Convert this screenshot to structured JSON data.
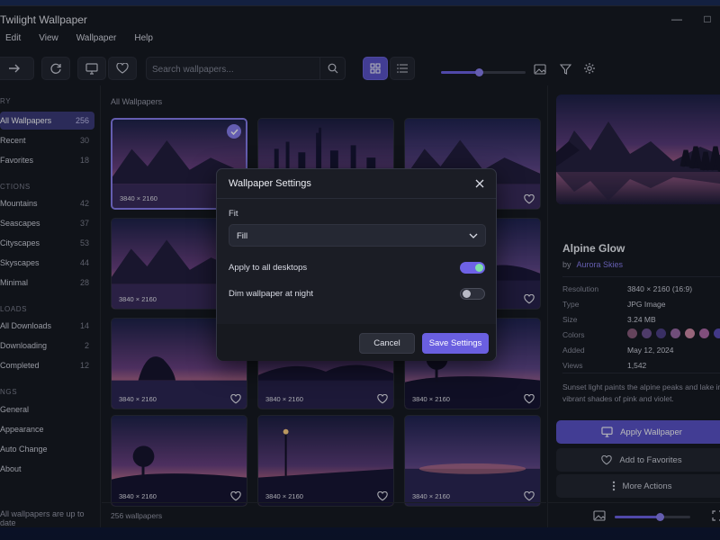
{
  "window": {
    "title": "Twilight Wallpaper",
    "controls": {
      "minimize": "—",
      "maximize": "□",
      "close": "✕"
    }
  },
  "menu": [
    "Edit",
    "View",
    "Wallpaper",
    "Help"
  ],
  "toolbar": {
    "search_placeholder": "Search wallpapers...",
    "zoom_level": 0.45,
    "view_mode": "grid"
  },
  "sidebar": {
    "sections": [
      {
        "title": "RY",
        "items": [
          {
            "label": "All Wallpapers",
            "count": "256",
            "selected": true
          },
          {
            "label": "Recent",
            "count": "30"
          },
          {
            "label": "Favorites",
            "count": "18"
          }
        ]
      },
      {
        "title": "CTIONS",
        "items": [
          {
            "label": "Mountains",
            "count": "42"
          },
          {
            "label": "Seascapes",
            "count": "37"
          },
          {
            "label": "Cityscapes",
            "count": "53"
          },
          {
            "label": "Skyscapes",
            "count": "44"
          },
          {
            "label": "Minimal",
            "count": "28"
          }
        ]
      },
      {
        "title": "LOADS",
        "items": [
          {
            "label": "All Downloads",
            "count": "14"
          },
          {
            "label": "Downloading",
            "count": "2"
          },
          {
            "label": "Completed",
            "count": "12"
          }
        ]
      },
      {
        "title": "NGS",
        "items": [
          {
            "label": "General"
          },
          {
            "label": "Appearance"
          },
          {
            "label": "Auto Change"
          },
          {
            "label": "About"
          }
        ]
      }
    ],
    "status": "All wallpapers are up to date"
  },
  "content": {
    "breadcrumb": "All Wallpapers",
    "cards": [
      {
        "resolution": "3840 × 2160",
        "scene": "alpine",
        "selected": true
      },
      {
        "resolution": "",
        "scene": "city"
      },
      {
        "resolution": "",
        "scene": "lake"
      },
      {
        "resolution": "3840 × 2160",
        "scene": "valley"
      },
      {
        "resolution": "",
        "scene": "hidden"
      },
      {
        "resolution": "",
        "scene": "hidden2"
      },
      {
        "resolution": "3840 × 2160",
        "scene": "rocks"
      },
      {
        "resolution": "3840 × 2160",
        "scene": "bridge"
      },
      {
        "resolution": "3840 × 2160",
        "scene": "forest"
      },
      {
        "resolution": "3840 × 2160",
        "scene": "tree"
      },
      {
        "resolution": "3840 × 2160",
        "scene": "promenade"
      },
      {
        "resolution": "3840 × 2160",
        "scene": "clouds"
      }
    ],
    "count": "256 wallpapers"
  },
  "details": {
    "name": "Alpine Glow",
    "by": "by",
    "author": "Aurora Skies",
    "rows": [
      {
        "key": "Resolution",
        "value": "3840 × 2160 (16:9)"
      },
      {
        "key": "Type",
        "value": "JPG Image"
      },
      {
        "key": "Size",
        "value": "3.24 MB"
      },
      {
        "key": "Colors",
        "value": ""
      },
      {
        "key": "Added",
        "value": "May 12, 2024"
      },
      {
        "key": "Views",
        "value": "1,542"
      }
    ],
    "colors": [
      "#8a5a7a",
      "#6b4f8e",
      "#4e3f86",
      "#9a6aa6",
      "#d089a6",
      "#b06aa8",
      "#5a4bb8"
    ],
    "description": "Sunset light paints the alpine peaks and lake in vibrant shades of pink and violet.",
    "apply_label": "Apply Wallpaper",
    "favorite_label": "Add to Favorites",
    "more_label": "More Actions",
    "preview_zoom": 0.6
  },
  "dialog": {
    "title": "Wallpaper Settings",
    "fit_label": "Fit",
    "fit_value": "Fill",
    "apply_all_label": "Apply to all desktops",
    "apply_all_on": true,
    "dim_label": "Dim wallpaper at night",
    "dim_on": false,
    "cancel_label": "Cancel",
    "save_label": "Save Settings"
  },
  "colors": {
    "accent": "#6a5fe0",
    "background": "#16181f",
    "toggle_on_knob": "#7fe0a6"
  }
}
